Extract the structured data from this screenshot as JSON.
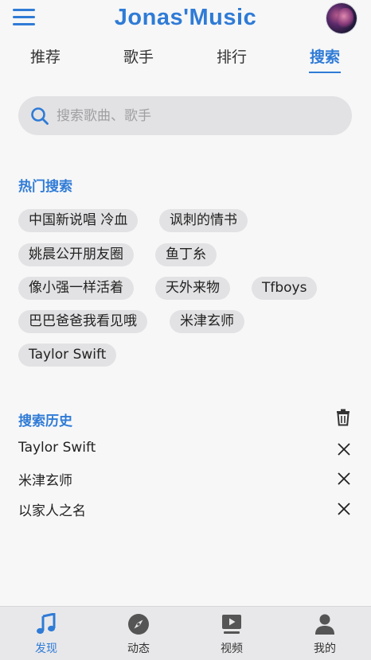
{
  "header": {
    "title": "Jonas'Music",
    "menu_icon": "hamburger-menu-icon",
    "avatar_icon": "user-avatar"
  },
  "tabs": [
    {
      "label": "推荐"
    },
    {
      "label": "歌手"
    },
    {
      "label": "排行"
    },
    {
      "label": "搜索",
      "active": true
    }
  ],
  "search": {
    "placeholder": "搜索歌曲、歌手",
    "value": "",
    "icon": "search-icon"
  },
  "hot_search": {
    "title": "热门搜索",
    "tags": [
      "中国新说唱 冷血",
      "讽刺的情书",
      "姚晨公开朋友圈",
      "鱼丁糸",
      "像小强一样活着",
      "天外来物",
      "Tfboys",
      "巴巴爸爸我看见哦",
      "米津玄师",
      "Taylor Swift"
    ]
  },
  "history": {
    "title": "搜索历史",
    "clear_icon": "trash-icon",
    "items": [
      "Taylor Swift",
      "米津玄师",
      "以家人之名"
    ]
  },
  "bottom_nav": [
    {
      "label": "发现",
      "icon": "music-note-icon",
      "active": true
    },
    {
      "label": "动态",
      "icon": "compass-icon"
    },
    {
      "label": "视频",
      "icon": "video-play-icon"
    },
    {
      "label": "我的",
      "icon": "user-icon"
    }
  ],
  "colors": {
    "accent": "#2f7bd6",
    "background": "#f7f7f8",
    "chip": "#e2e2e4",
    "nav_bar": "#e8e8ea"
  }
}
